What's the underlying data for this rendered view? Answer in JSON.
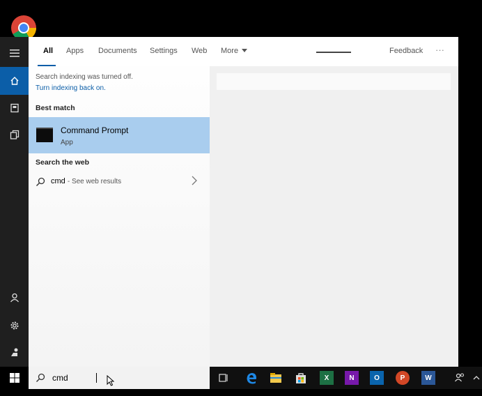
{
  "tabs": [
    {
      "label": "All"
    },
    {
      "label": "Apps"
    },
    {
      "label": "Documents"
    },
    {
      "label": "Settings"
    },
    {
      "label": "Web"
    },
    {
      "label": "More"
    }
  ],
  "feedback_label": "Feedback",
  "overflow_label": "···",
  "indexing": {
    "notice": "Search indexing was turned off.",
    "link": "Turn indexing back on."
  },
  "best_match": {
    "heading": "Best match",
    "title": "Command Prompt",
    "subtitle": "App"
  },
  "web": {
    "heading": "Search the web",
    "query": "cmd",
    "hint": "- See web results"
  },
  "search_box": {
    "value": "cmd"
  },
  "taskbar": {
    "excel": "X",
    "onenote": "N",
    "outlook": "O",
    "powerpoint": "P",
    "word": "W"
  },
  "colors": {
    "accent": "#0b5ea8",
    "selection": "#a9cdee",
    "rail": "#1f1f1f",
    "taskbar": "#101010"
  }
}
